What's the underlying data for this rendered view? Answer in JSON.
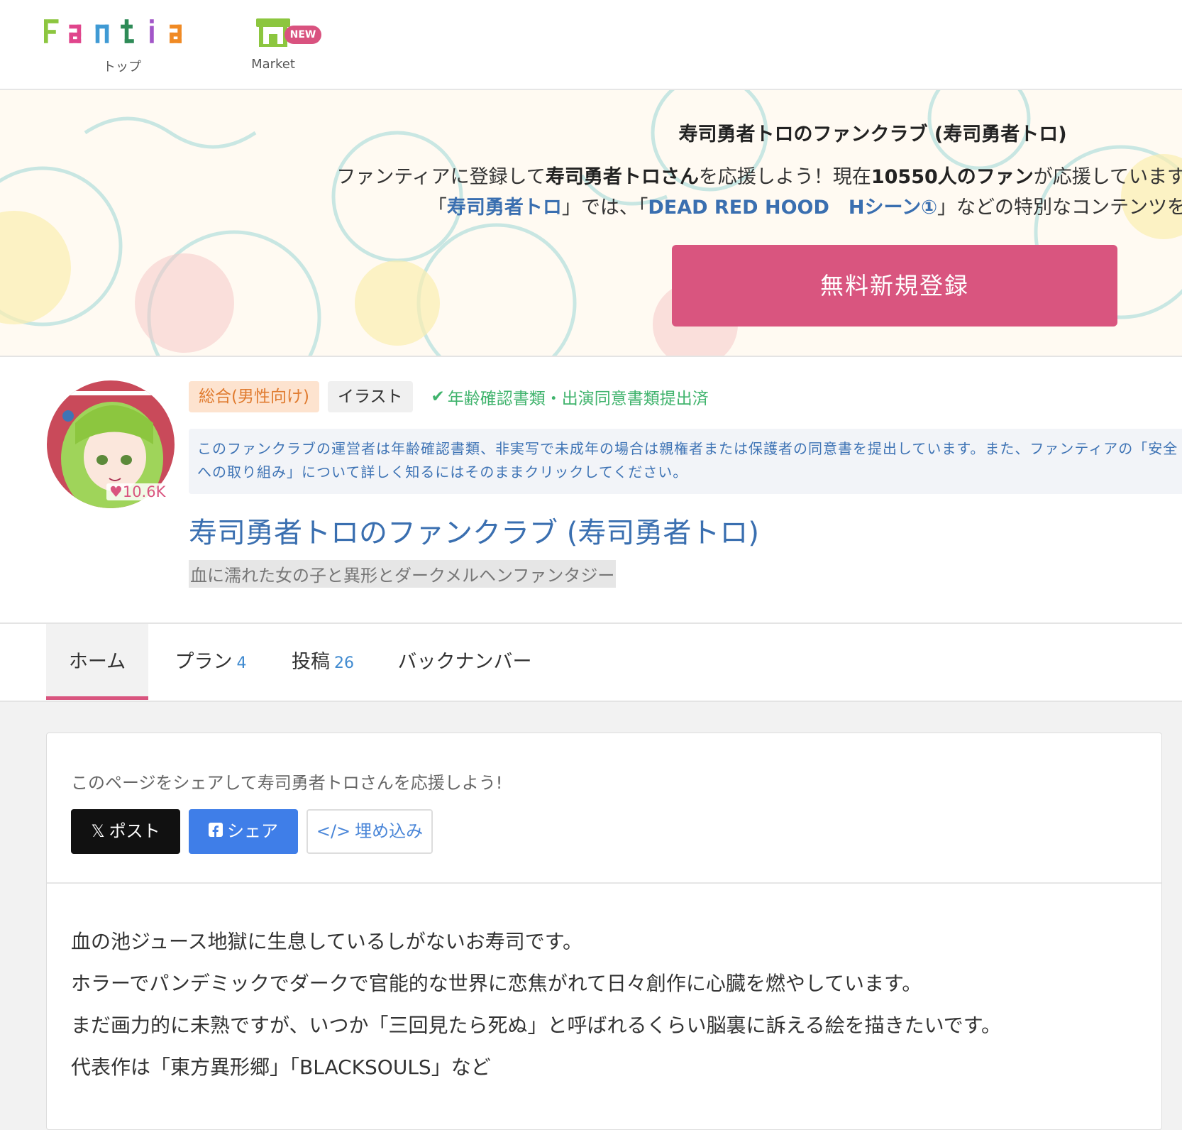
{
  "header": {
    "logo_text": "Fantia",
    "top_label": "トップ",
    "market_label": "Market",
    "new_badge": "NEW"
  },
  "banner": {
    "title": "寿司勇者トロのファンクラブ (寿司勇者トロ)",
    "line1": {
      "pre": "ファンティアに登録して",
      "creator": "寿司勇者トロさん",
      "mid": "を応援しよう！現在",
      "fans": "10550人のファン",
      "post": "が応援しています"
    },
    "line2": {
      "q1": "「",
      "creator_link": "寿司勇者トロ",
      "mid": "」では、「",
      "content_link": "DEAD RED HOOD　Hシーン①",
      "post": "」などの特別なコンテンツを"
    },
    "register_button": "無料新規登録"
  },
  "profile": {
    "likes": "10.6K",
    "tags": [
      "総合(男性向け)",
      "イラスト"
    ],
    "verified": "年齢確認書類・出演同意書類提出済",
    "notice": "このファンクラブの運営者は年齢確認書類、非実写で未成年の場合は親権者または保護者の同意書を提出しています。また、ファンティアの「安全への取り組み」について詳しく知るにはそのままクリックしてください。",
    "club_name": "寿司勇者トロのファンクラブ (寿司勇者トロ)",
    "tagline": "血に濡れた女の子と異形とダークメルヘンファンタジー"
  },
  "tabs": [
    {
      "label": "ホーム",
      "count": ""
    },
    {
      "label": "プラン",
      "count": "4"
    },
    {
      "label": "投稿",
      "count": "26"
    },
    {
      "label": "バックナンバー",
      "count": ""
    }
  ],
  "share": {
    "text": "このページをシェアして寿司勇者トロさんを応援しよう!",
    "post_button": "ポスト",
    "share_button": "シェア",
    "embed_button": "埋め込み"
  },
  "bio": [
    "血の池ジュース地獄に生息しているしがないお寿司です。",
    "ホラーでパンデミックでダークで官能的な世界に恋焦がれて日々創作に心臓を燃やしています。",
    "まだ画力的に未熟ですが、いつか「三回見たら死ぬ」と呼ばれるくらい脳裏に訴える絵を描きたいです。",
    "代表作は「東方異形郷」「BLACKSOULS」など"
  ],
  "colors": {
    "accent": "#d9557f",
    "link": "#3a6fb0",
    "verified": "#3fb36c",
    "facebook": "#3f7ee8"
  }
}
